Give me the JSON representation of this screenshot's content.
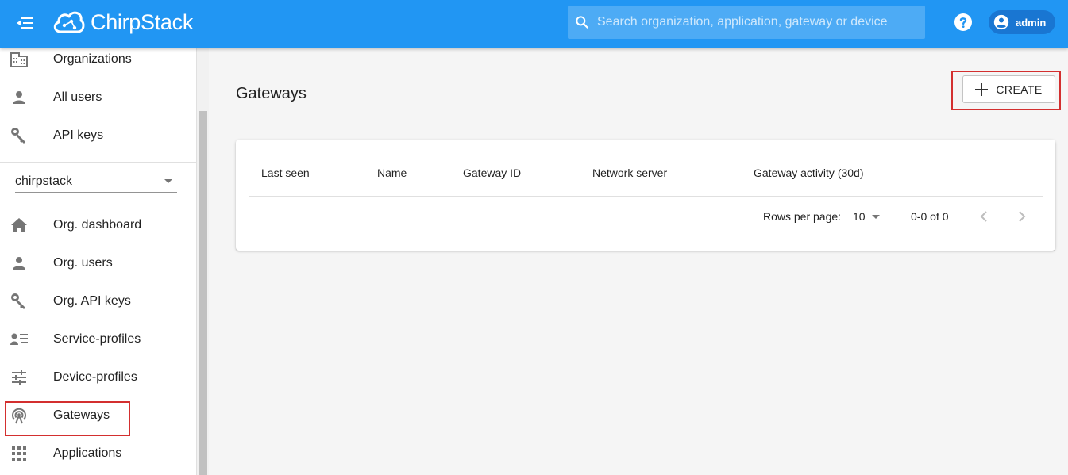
{
  "app": {
    "brand": "ChirpStack",
    "colors": {
      "primary": "#2196f3",
      "chip": "#1976d2",
      "highlight": "#d32f2f"
    }
  },
  "header": {
    "search_placeholder": "Search organization, application, gateway or device",
    "user_name": "admin"
  },
  "sidebar": {
    "admin_items": [
      {
        "label": "Organizations",
        "icon": "domain-icon"
      },
      {
        "label": "All users",
        "icon": "person-icon"
      },
      {
        "label": "API keys",
        "icon": "key-icon"
      }
    ],
    "organization_selected": "chirpstack",
    "org_items": [
      {
        "label": "Org. dashboard",
        "icon": "home-icon"
      },
      {
        "label": "Org. users",
        "icon": "person-icon"
      },
      {
        "label": "Org. API keys",
        "icon": "key-icon"
      },
      {
        "label": "Service-profiles",
        "icon": "account-details-icon"
      },
      {
        "label": "Device-profiles",
        "icon": "tune-icon"
      },
      {
        "label": "Gateways",
        "icon": "radio-tower-icon"
      },
      {
        "label": "Applications",
        "icon": "apps-grid-icon"
      }
    ]
  },
  "main": {
    "title": "Gateways",
    "create_label": "CREATE",
    "table": {
      "columns": [
        "Last seen",
        "Name",
        "Gateway ID",
        "Network server",
        "Gateway activity (30d)"
      ],
      "rows": []
    },
    "pagination": {
      "rows_per_page_label": "Rows per page:",
      "rows_per_page": "10",
      "range": "0-0 of 0"
    }
  }
}
